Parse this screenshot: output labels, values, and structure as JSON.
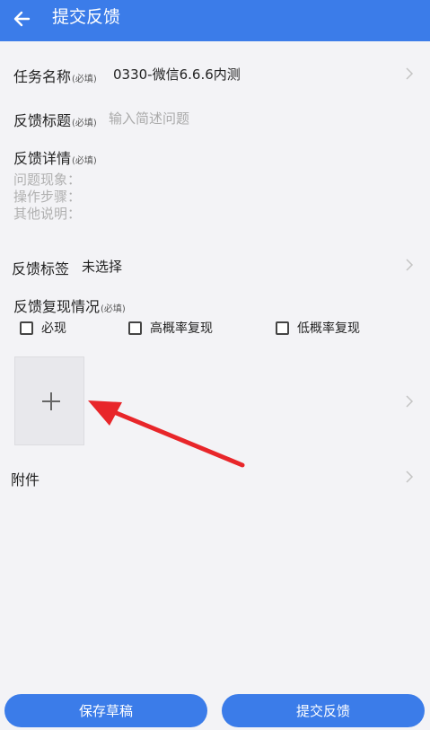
{
  "header": {
    "title": "提交反馈",
    "back_icon": "arrow-left-icon"
  },
  "task": {
    "label": "任务名称",
    "required": "(必填)",
    "value": "0330-微信6.6.6内测"
  },
  "feedback_title": {
    "label": "反馈标题",
    "required": "(必填)",
    "placeholder": "输入简述问题"
  },
  "feedback_detail": {
    "label": "反馈详情",
    "required": "(必填)",
    "placeholder_lines": [
      "问题现象：",
      "操作步骤：",
      "其他说明："
    ]
  },
  "tags": {
    "label": "反馈标签",
    "value": "未选择"
  },
  "reproduce": {
    "label": "反馈复现情况",
    "required": "(必填)",
    "options": [
      "必现",
      "高概率复现",
      "低概率复现"
    ]
  },
  "upload": {
    "icon": "plus-icon"
  },
  "annotation": {
    "color": "#e8262a"
  },
  "attachment": {
    "label": "附件"
  },
  "footer": {
    "save_label": "保存草稿",
    "submit_label": "提交反馈"
  },
  "colors": {
    "accent": "#3b7ce9",
    "background": "#f3f3f6"
  }
}
